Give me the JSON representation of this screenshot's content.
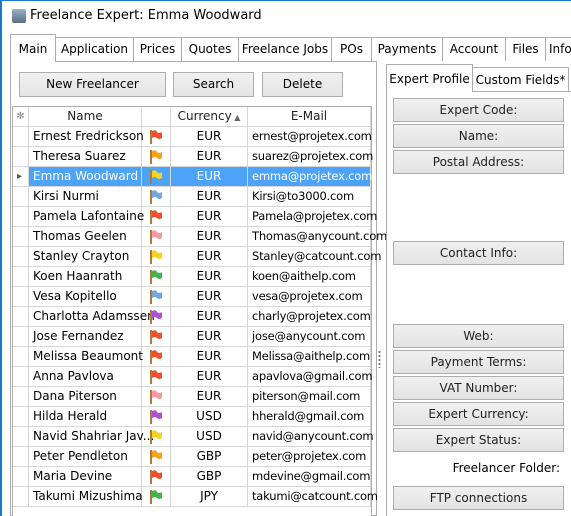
{
  "window": {
    "title": "Freelance Expert: Emma Woodward"
  },
  "tabs": [
    {
      "label": "Main",
      "active": true
    },
    {
      "label": "Application"
    },
    {
      "label": "Prices"
    },
    {
      "label": "Quotes"
    },
    {
      "label": "Freelance Jobs"
    },
    {
      "label": "POs"
    },
    {
      "label": "Payments"
    },
    {
      "label": "Account"
    },
    {
      "label": "Files"
    },
    {
      "label": "Info"
    }
  ],
  "toolbar": {
    "new_label": "New Freelancer",
    "search_label": "Search",
    "delete_label": "Delete"
  },
  "grid": {
    "columns": [
      "",
      "Name",
      "",
      "Currency",
      "E-Mail"
    ],
    "sort_column": "Currency",
    "sort_dir": "asc",
    "rows": [
      {
        "name": "Ernest Fredrickson",
        "flag": "#f0502c",
        "currency": "EUR",
        "email": "ernest@projetex.com"
      },
      {
        "name": "Theresa Suarez",
        "flag": "#f8a21c",
        "currency": "EUR",
        "email": "suarez@projetex.com"
      },
      {
        "name": "Emma Woodward",
        "flag": "#f5d320",
        "currency": "EUR",
        "email": "emma@projetex.com",
        "selected": true
      },
      {
        "name": "Kirsi Nurmi",
        "flag": "#6fa8e0",
        "currency": "EUR",
        "email": "Kirsi@to3000.com"
      },
      {
        "name": "Pamela Lafontaine",
        "flag": "#f0502c",
        "currency": "EUR",
        "email": "Pamela@projetex.com"
      },
      {
        "name": "Thomas Geelen",
        "flag": "#f79aa0",
        "currency": "EUR",
        "email": "Thomas@anycount.com"
      },
      {
        "name": "Stanley Crayton",
        "flag": "#f5d320",
        "currency": "EUR",
        "email": "Stanley@catcount.com"
      },
      {
        "name": "Koen Haanrath",
        "flag": "#3fb54a",
        "currency": "EUR",
        "email": "koen@aithelp.com"
      },
      {
        "name": "Vesa Kopitello",
        "flag": "#6fa8e0",
        "currency": "EUR",
        "email": "vesa@projetex.com"
      },
      {
        "name": "Charlotta Adamssen",
        "flag": "#b050d8",
        "currency": "EUR",
        "email": "charly@projetex.com"
      },
      {
        "name": "Jose Fernandez",
        "flag": "#f0502c",
        "currency": "EUR",
        "email": "jose@anycount.com"
      },
      {
        "name": "Melissa Beaumont",
        "flag": "#f0502c",
        "currency": "EUR",
        "email": "Melissa@aithelp.com"
      },
      {
        "name": "Anna Pavlova",
        "flag": "#f0502c",
        "currency": "EUR",
        "email": "apavlova@gmail.com"
      },
      {
        "name": "Dana Piterson",
        "flag": "#f79aa0",
        "currency": "EUR",
        "email": "piterson@mail.com"
      },
      {
        "name": "Hilda Herald",
        "flag": "#b050d8",
        "currency": "USD",
        "email": "hherald@gmail.com"
      },
      {
        "name": "Navid Shahriar Jav...",
        "flag": "#f5d320",
        "currency": "USD",
        "email": "navid@anycount.com"
      },
      {
        "name": "Peter Pendleton",
        "flag": "#f8a21c",
        "currency": "GBP",
        "email": "peter@projetex.com"
      },
      {
        "name": "Maria Devine",
        "flag": "#f0502c",
        "currency": "GBP",
        "email": "mdevine@gmail.com"
      },
      {
        "name": "Takumi Mizushima",
        "flag": "#3fb54a",
        "currency": "JPY",
        "email": "takumi@catcount.com"
      }
    ]
  },
  "right_tabs": [
    {
      "label": "Expert Profile",
      "active": true
    },
    {
      "label": "Custom Fields*"
    }
  ],
  "profile": {
    "expert_code": "Expert Code:",
    "name": "Name:",
    "postal_address": "Postal Address:",
    "contact_info": "Contact Info:",
    "web": "Web:",
    "payment_terms": "Payment Terms:",
    "vat_number": "VAT Number:",
    "expert_currency": "Expert Currency:",
    "expert_status": "Expert Status:",
    "freelancer_folder": "Freelancer Folder:",
    "ftp": "FTP connections"
  },
  "colors": {
    "selection": "#4da3f7",
    "window_border": "#1979ca"
  }
}
